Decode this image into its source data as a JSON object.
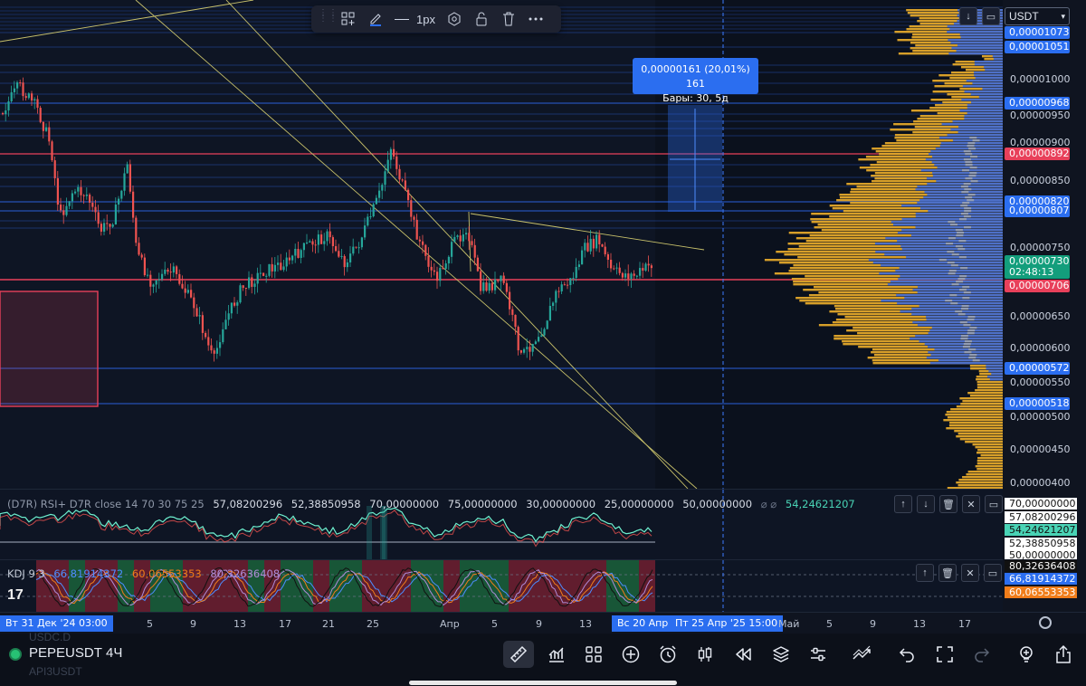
{
  "toolbar": {
    "line_width_label": "1px"
  },
  "price_axis": {
    "currency": "USDT",
    "ticks": [
      "0,00001000",
      "0,00000950",
      "0,00000900",
      "0,00000850",
      "0,00000750",
      "0,00000650",
      "0,00000600",
      "0,00000550",
      "0,00000500",
      "0,00000450",
      "0,00000400"
    ],
    "badges": [
      {
        "text": "0,00001073",
        "color": "#2b6ef0"
      },
      {
        "text": "0,00001051",
        "color": "#2b6ef0"
      },
      {
        "text": "0,00000968",
        "color": "#2b6ef0"
      },
      {
        "text": "0,00000892",
        "color": "#e8405a"
      },
      {
        "text": "0,00000820",
        "color": "#2b6ef0"
      },
      {
        "text": "0,00000807",
        "color": "#2b6ef0"
      },
      {
        "text": "0,00000730",
        "color": "#139e7c"
      },
      {
        "text": "02:48:13",
        "color": "#139e7c"
      },
      {
        "text": "0,00000706",
        "color": "#e8405a"
      },
      {
        "text": "0,00000572",
        "color": "#2b6ef0"
      },
      {
        "text": "0,00000518",
        "color": "#2b6ef0"
      }
    ]
  },
  "measure": {
    "line1": "0,00000161 (20,01%) 161",
    "line2": "Бары: 30, 5д"
  },
  "rsi": {
    "legend_name": "(D7R) RSI+ D7R close 14 70 30 75 25",
    "legend_values": [
      "57,08200296",
      "52,38850958",
      "70,00000000",
      "75,00000000",
      "30,00000000",
      "25,00000000",
      "50,00000000"
    ],
    "legend_tail": "⌀ ⌀",
    "legend_last": "54,24621207",
    "axis_values": [
      {
        "text": "70,00000000",
        "bg": "#ffffff",
        "fg": "#111111"
      },
      {
        "text": "57,08200296",
        "bg": "#ffffff",
        "fg": "#111111"
      },
      {
        "text": "54,24621207",
        "bg": "#49d3b5",
        "fg": "#111111"
      },
      {
        "text": "52,38850958",
        "bg": "#ffffff",
        "fg": "#111111"
      },
      {
        "text": "50,00000000",
        "bg": "#ffffff",
        "fg": "#111111"
      }
    ]
  },
  "kdj": {
    "legend_name": "KDJ 9 3",
    "k_value": "66,81914372",
    "d_value": "60,06553353",
    "j_value": "80,32636408",
    "axis_values": [
      {
        "text": "80,32636408",
        "bg": "#111111",
        "fg": "#ffffff"
      },
      {
        "text": "66,81914372",
        "bg": "#2b6ef0",
        "fg": "#ffffff"
      },
      {
        "text": "60,06553353",
        "bg": "#f07d1a",
        "fg": "#ffffff"
      }
    ]
  },
  "time_axis": {
    "start_badge": "Вт 31 Дек '24   03:00",
    "labels": [
      "5",
      "9",
      "13",
      "17",
      "21",
      "25",
      "Апр",
      "5",
      "9",
      "13"
    ],
    "cursor_badge_left": "Вс 20 Апр",
    "cursor_badge_right": "Пт 25 Апр '25   15:00",
    "labels_right": [
      "Май",
      "5",
      "9",
      "13",
      "17"
    ]
  },
  "bottom_bar": {
    "symbol": "PEPEUSDT",
    "timeframe": "4Ч",
    "ghost_above": "USDC.D",
    "ghost_below": "API3USDT"
  },
  "colors": {
    "bull": "#26a69a",
    "bear": "#ef5350",
    "accent": "#2b6ef0",
    "volume_profile": "#e3a82a"
  }
}
